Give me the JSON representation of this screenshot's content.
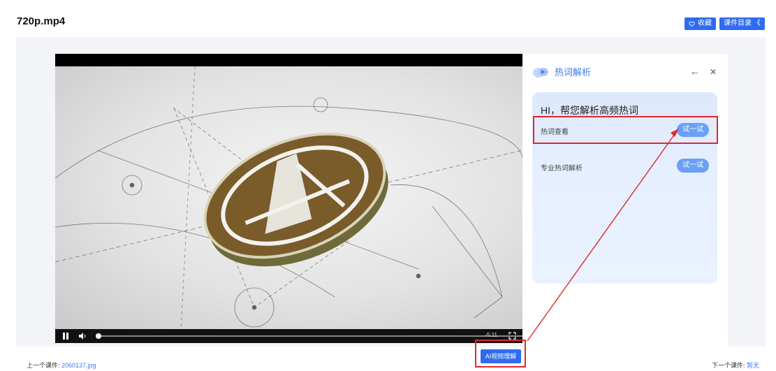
{
  "header": {
    "title": "720p.mp4"
  },
  "top_buttons": {
    "favorite_label": "收藏",
    "catalog_label": "课件目录 《"
  },
  "player": {
    "time": "-5:11"
  },
  "hotword_panel": {
    "title": "热词解析",
    "back_icon": "←",
    "close_icon": "✕",
    "greeting": "HI，帮您解析高频热词",
    "rows": [
      {
        "label": "热词查看",
        "button": "试一试"
      },
      {
        "label": "专业热词解析",
        "button": "试一试"
      }
    ]
  },
  "ai_button": {
    "label": "AI视频理解"
  },
  "footer": {
    "prev_label": "上一个课件:",
    "prev_value": "2060137.jpg",
    "next_label": "下一个课件:",
    "next_value": "暂无"
  },
  "colors": {
    "accent": "#2f6bf0",
    "highlight": "#e0282d",
    "panel_title": "#3a7bf7"
  },
  "icons": [
    "heart-icon",
    "play-pause-icon",
    "volume-icon",
    "fullscreen-icon",
    "cloud-logo-icon",
    "back-arrow-icon",
    "close-icon"
  ]
}
